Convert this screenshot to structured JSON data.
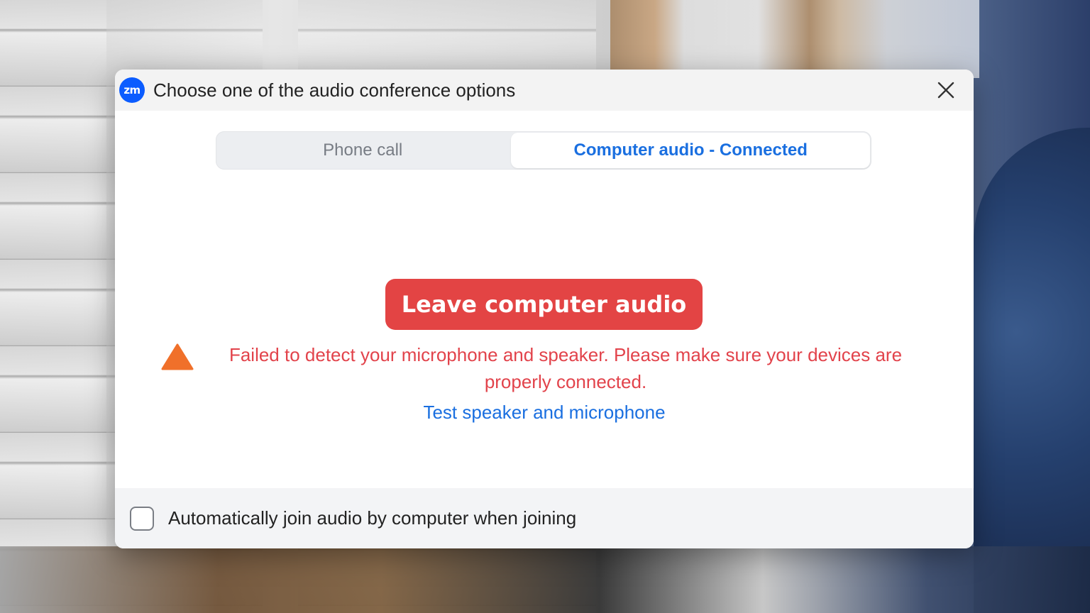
{
  "dialog": {
    "title": "Choose one of the audio conference options",
    "logo_text": "zm",
    "close_icon": "close-icon"
  },
  "tabs": [
    {
      "label": "Phone call",
      "selected": false
    },
    {
      "label": "Computer audio - Connected",
      "selected": true
    }
  ],
  "leave_button": {
    "label": "Leave computer audio"
  },
  "warning": {
    "icon": "warning-triangle-icon",
    "text": "Failed to detect your microphone and speaker. Please make sure your devices are properly connected."
  },
  "test_link": {
    "label": "Test speaker and microphone"
  },
  "footer": {
    "checkbox_checked": false,
    "label": "Automatically join audio by computer when joining"
  },
  "colors": {
    "accent_blue": "#1a6fe0",
    "danger_red": "#e34444",
    "warning_orange": "#f0702a",
    "zoom_blue": "#0b5cff"
  }
}
